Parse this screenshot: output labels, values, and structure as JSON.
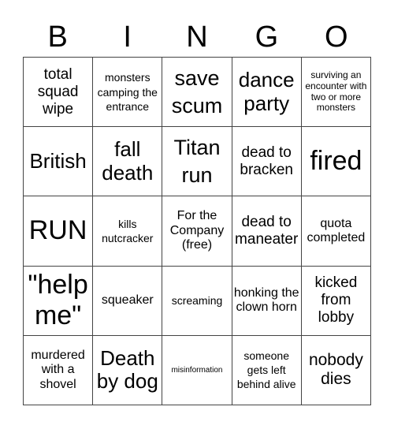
{
  "header": [
    "B",
    "I",
    "N",
    "G",
    "O"
  ],
  "cells": [
    "total squad wipe",
    "monsters camping the entrance",
    "save scum",
    "dance party",
    "surviving an encounter with two or more monsters",
    "British",
    "fall death",
    "Titan run",
    "dead to bracken",
    "fired",
    "RUN",
    "kills nutcracker",
    "For the Company (free)",
    "dead to maneater",
    "quota completed",
    "\"help me\"",
    "squeaker",
    "screaming",
    "honking the clown horn",
    "kicked from lobby",
    "murdered with a shovel",
    "Death by dog",
    "misinformation",
    "someone gets left behind alive",
    "nobody dies"
  ]
}
